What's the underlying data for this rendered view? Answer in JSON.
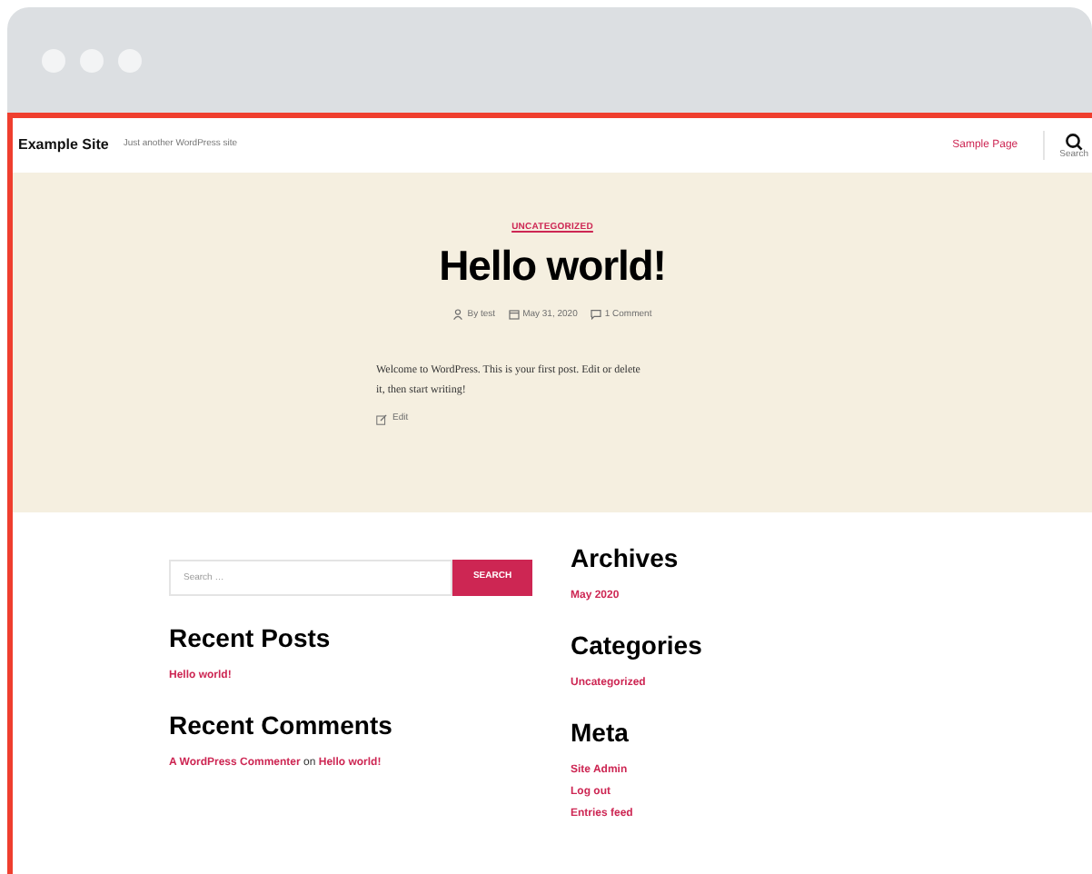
{
  "site": {
    "title": "Example Site",
    "tagline": "Just another WordPress site",
    "nav": [
      {
        "label": "Sample Page"
      }
    ],
    "search_toggle": "Search"
  },
  "post": {
    "category": "UNCATEGORIZED",
    "title": "Hello world!",
    "author": "By test",
    "date": "May 31, 2020",
    "comments": "1 Comment",
    "body": "Welcome to WordPress. This is your first post. Edit or delete it, then start writing!",
    "edit": "Edit"
  },
  "search": {
    "placeholder": "Search …",
    "button": "SEARCH"
  },
  "widgets_left": [
    {
      "title": "Recent Posts",
      "items": [
        {
          "parts": [
            "Hello world!"
          ]
        }
      ]
    },
    {
      "title": "Recent Comments",
      "items": [
        {
          "parts": [
            "A WordPress Commenter",
            " on ",
            "Hello world!"
          ]
        }
      ]
    }
  ],
  "widgets_right": [
    {
      "title": "Archives",
      "items": [
        {
          "parts": [
            "May 2020"
          ]
        }
      ]
    },
    {
      "title": "Categories",
      "items": [
        {
          "parts": [
            "Uncategorized"
          ]
        }
      ]
    },
    {
      "title": "Meta",
      "items": [
        {
          "parts": [
            "Site Admin"
          ]
        },
        {
          "parts": [
            "Log out"
          ]
        },
        {
          "parts": [
            "Entries feed"
          ]
        }
      ]
    }
  ]
}
